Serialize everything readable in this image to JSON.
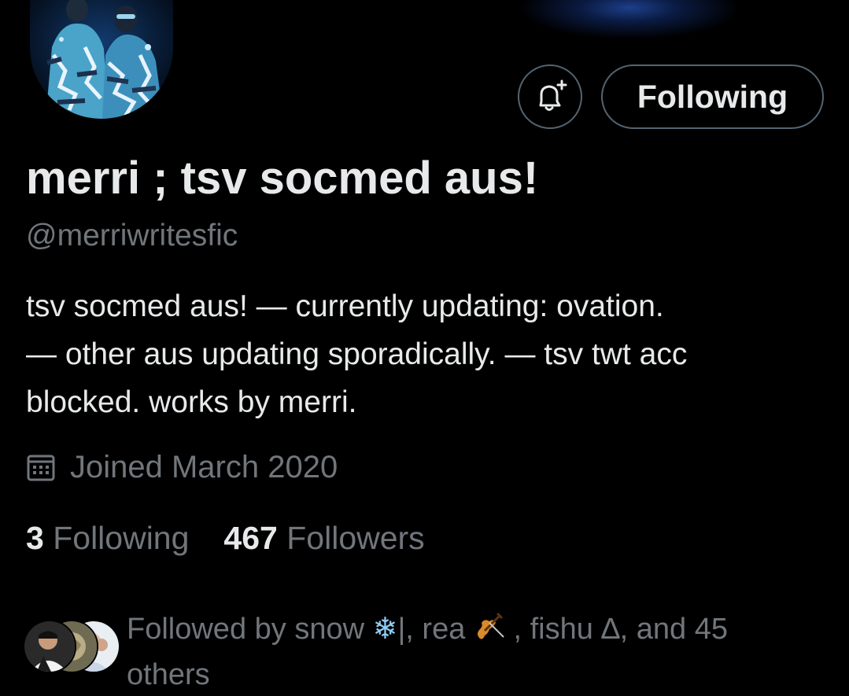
{
  "profile": {
    "display_name": "merri ; tsv socmed aus!",
    "handle": "@merriwritesfic",
    "bio_lines": [
      "tsv socmed aus! — currently updating: ovation.",
      "— other aus updating sporadically. — tsv twt acc",
      "blocked. works by merri."
    ],
    "joined": "Joined March 2020",
    "following_count": "3",
    "following_label": "Following",
    "followers_count": "467",
    "followers_label": "Followers"
  },
  "actions": {
    "notify_icon": "bell-plus-icon",
    "follow_button_label": "Following"
  },
  "followed_by": {
    "line1_prefix": "Followed by snow ",
    "snow_emoji": "❄",
    "line1_after_snow": "|, rea ",
    "violin_emoji": "🎻",
    "line1_after_violin": " , fishu ∆, and 45",
    "line2": "others"
  },
  "colors": {
    "background": "#000000",
    "primary_text": "#e7e9ea",
    "secondary_text": "#71767b",
    "button_border": "#536471",
    "snow_blue": "#8ecdf5"
  }
}
